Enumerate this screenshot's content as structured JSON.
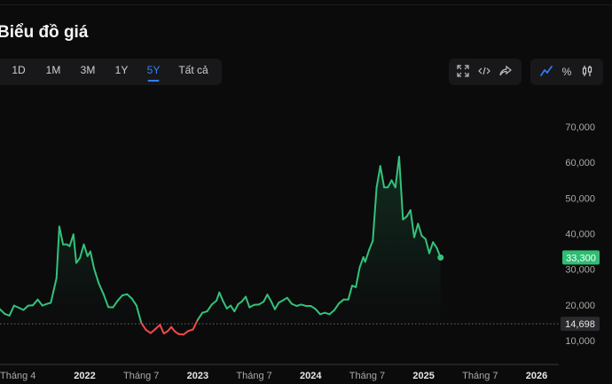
{
  "header": {
    "title": "Biểu đồ giá"
  },
  "ranges": [
    {
      "label": "1D",
      "active": false
    },
    {
      "label": "1M",
      "active": false
    },
    {
      "label": "3M",
      "active": false
    },
    {
      "label": "1Y",
      "active": false
    },
    {
      "label": "5Y",
      "active": true
    },
    {
      "label": "Tất cả",
      "active": false
    }
  ],
  "tools": [
    {
      "icon": "expand-icon"
    },
    {
      "icon": "embed-code-icon"
    },
    {
      "icon": "share-icon"
    }
  ],
  "modes": [
    {
      "icon": "line-chart-icon",
      "active": true
    },
    {
      "label": "%",
      "icon": "percent-icon",
      "active": false
    },
    {
      "icon": "candlestick-icon",
      "active": false
    }
  ],
  "colors": {
    "up": "#33c27a",
    "down": "#f04a4a",
    "accent": "#2f80ff",
    "price_badge": "#2ebd73",
    "ref_badge": "#2a2a2e"
  },
  "chart_data": {
    "type": "line",
    "y_ticks": [
      "70,000",
      "60,000",
      "50,000",
      "40,000",
      "30,000",
      "20,000",
      "10,000"
    ],
    "y_tick_values": [
      70000,
      60000,
      50000,
      40000,
      30000,
      20000,
      10000
    ],
    "ylim": [
      5000,
      80000
    ],
    "x_ticks": [
      {
        "label": "Tháng 4",
        "t": 0,
        "year": false
      },
      {
        "label": "2022",
        "t": 9,
        "year": true
      },
      {
        "label": "Tháng 7",
        "t": 15,
        "year": false
      },
      {
        "label": "2023",
        "t": 21,
        "year": true
      },
      {
        "label": "Tháng 7",
        "t": 27,
        "year": false
      },
      {
        "label": "2024",
        "t": 33,
        "year": true
      },
      {
        "label": "Tháng 7",
        "t": 39,
        "year": false
      },
      {
        "label": "2025",
        "t": 45,
        "year": true
      },
      {
        "label": "Tháng 7",
        "t": 51,
        "year": false
      },
      {
        "label": "2026",
        "t": 57,
        "year": true
      }
    ],
    "reference_value": 14698,
    "reference_label": "14,698",
    "last_price_label": "33,300",
    "last_price": 33300,
    "series": [
      {
        "t": 0,
        "v": 18800
      },
      {
        "t": 0.5,
        "v": 17500
      },
      {
        "t": 1,
        "v": 17000
      },
      {
        "t": 1.5,
        "v": 19800
      },
      {
        "t": 2,
        "v": 19200
      },
      {
        "t": 2.5,
        "v": 18600
      },
      {
        "t": 3,
        "v": 19800
      },
      {
        "t": 3.5,
        "v": 19900
      },
      {
        "t": 4,
        "v": 21500
      },
      {
        "t": 4.5,
        "v": 19800
      },
      {
        "t": 5,
        "v": 20300
      },
      {
        "t": 5.4,
        "v": 20600
      },
      {
        "t": 6,
        "v": 27500
      },
      {
        "t": 6.3,
        "v": 42000
      },
      {
        "t": 6.7,
        "v": 37000
      },
      {
        "t": 7.1,
        "v": 37000
      },
      {
        "t": 7.4,
        "v": 36500
      },
      {
        "t": 7.8,
        "v": 39800
      },
      {
        "t": 8.1,
        "v": 31800
      },
      {
        "t": 8.5,
        "v": 33200
      },
      {
        "t": 8.9,
        "v": 37000
      },
      {
        "t": 9.3,
        "v": 33700
      },
      {
        "t": 9.6,
        "v": 35000
      },
      {
        "t": 10,
        "v": 30200
      },
      {
        "t": 10.5,
        "v": 26000
      },
      {
        "t": 11,
        "v": 23000
      },
      {
        "t": 11.5,
        "v": 19400
      },
      {
        "t": 12,
        "v": 19300
      },
      {
        "t": 12.5,
        "v": 21200
      },
      {
        "t": 13,
        "v": 22700
      },
      {
        "t": 13.5,
        "v": 23000
      },
      {
        "t": 14,
        "v": 21800
      },
      {
        "t": 14.5,
        "v": 19800
      },
      {
        "t": 15,
        "v": 15000
      },
      {
        "t": 15.5,
        "v": 13000
      },
      {
        "t": 16,
        "v": 12100
      },
      {
        "t": 16.5,
        "v": 13200
      },
      {
        "t": 17,
        "v": 14400
      },
      {
        "t": 17.4,
        "v": 12000
      },
      {
        "t": 17.8,
        "v": 12600
      },
      {
        "t": 18.2,
        "v": 13800
      },
      {
        "t": 18.6,
        "v": 12500
      },
      {
        "t": 19,
        "v": 11800
      },
      {
        "t": 19.5,
        "v": 11700
      },
      {
        "t": 20,
        "v": 12700
      },
      {
        "t": 20.5,
        "v": 13100
      },
      {
        "t": 21,
        "v": 15800
      },
      {
        "t": 21.5,
        "v": 17800
      },
      {
        "t": 22,
        "v": 18200
      },
      {
        "t": 22.5,
        "v": 20100
      },
      {
        "t": 23,
        "v": 21200
      },
      {
        "t": 23.3,
        "v": 23500
      },
      {
        "t": 23.7,
        "v": 21000
      },
      {
        "t": 24.1,
        "v": 19000
      },
      {
        "t": 24.5,
        "v": 19800
      },
      {
        "t": 24.9,
        "v": 18200
      },
      {
        "t": 25.3,
        "v": 20200
      },
      {
        "t": 25.7,
        "v": 21000
      },
      {
        "t": 26.1,
        "v": 22300
      },
      {
        "t": 26.5,
        "v": 19300
      },
      {
        "t": 27,
        "v": 20000
      },
      {
        "t": 27.5,
        "v": 20100
      },
      {
        "t": 28,
        "v": 20900
      },
      {
        "t": 28.4,
        "v": 22900
      },
      {
        "t": 28.8,
        "v": 21000
      },
      {
        "t": 29.2,
        "v": 18800
      },
      {
        "t": 29.6,
        "v": 20600
      },
      {
        "t": 30,
        "v": 21200
      },
      {
        "t": 30.5,
        "v": 22000
      },
      {
        "t": 31,
        "v": 20300
      },
      {
        "t": 31.5,
        "v": 19700
      },
      {
        "t": 32,
        "v": 20100
      },
      {
        "t": 32.5,
        "v": 19700
      },
      {
        "t": 33,
        "v": 19700
      },
      {
        "t": 33.5,
        "v": 18900
      },
      {
        "t": 34,
        "v": 17400
      },
      {
        "t": 34.5,
        "v": 17800
      },
      {
        "t": 35,
        "v": 17400
      },
      {
        "t": 35.5,
        "v": 18500
      },
      {
        "t": 36,
        "v": 20400
      },
      {
        "t": 36.5,
        "v": 21500
      },
      {
        "t": 37,
        "v": 21500
      },
      {
        "t": 37.4,
        "v": 25400
      },
      {
        "t": 37.8,
        "v": 25000
      },
      {
        "t": 38.2,
        "v": 30500
      },
      {
        "t": 38.6,
        "v": 33400
      },
      {
        "t": 38.8,
        "v": 32100
      },
      {
        "t": 39.2,
        "v": 35400
      },
      {
        "t": 39.6,
        "v": 38000
      },
      {
        "t": 40,
        "v": 53000
      },
      {
        "t": 40.4,
        "v": 59000
      },
      {
        "t": 40.8,
        "v": 53000
      },
      {
        "t": 41.2,
        "v": 53000
      },
      {
        "t": 41.6,
        "v": 55000
      },
      {
        "t": 42,
        "v": 53000
      },
      {
        "t": 42.4,
        "v": 61600
      },
      {
        "t": 42.8,
        "v": 44000
      },
      {
        "t": 43.2,
        "v": 44800
      },
      {
        "t": 43.6,
        "v": 46600
      },
      {
        "t": 44,
        "v": 39000
      },
      {
        "t": 44.4,
        "v": 42800
      },
      {
        "t": 44.8,
        "v": 39400
      },
      {
        "t": 45.2,
        "v": 38500
      },
      {
        "t": 45.6,
        "v": 34500
      },
      {
        "t": 46,
        "v": 37600
      },
      {
        "t": 46.4,
        "v": 36000
      },
      {
        "t": 46.8,
        "v": 33300
      }
    ]
  }
}
